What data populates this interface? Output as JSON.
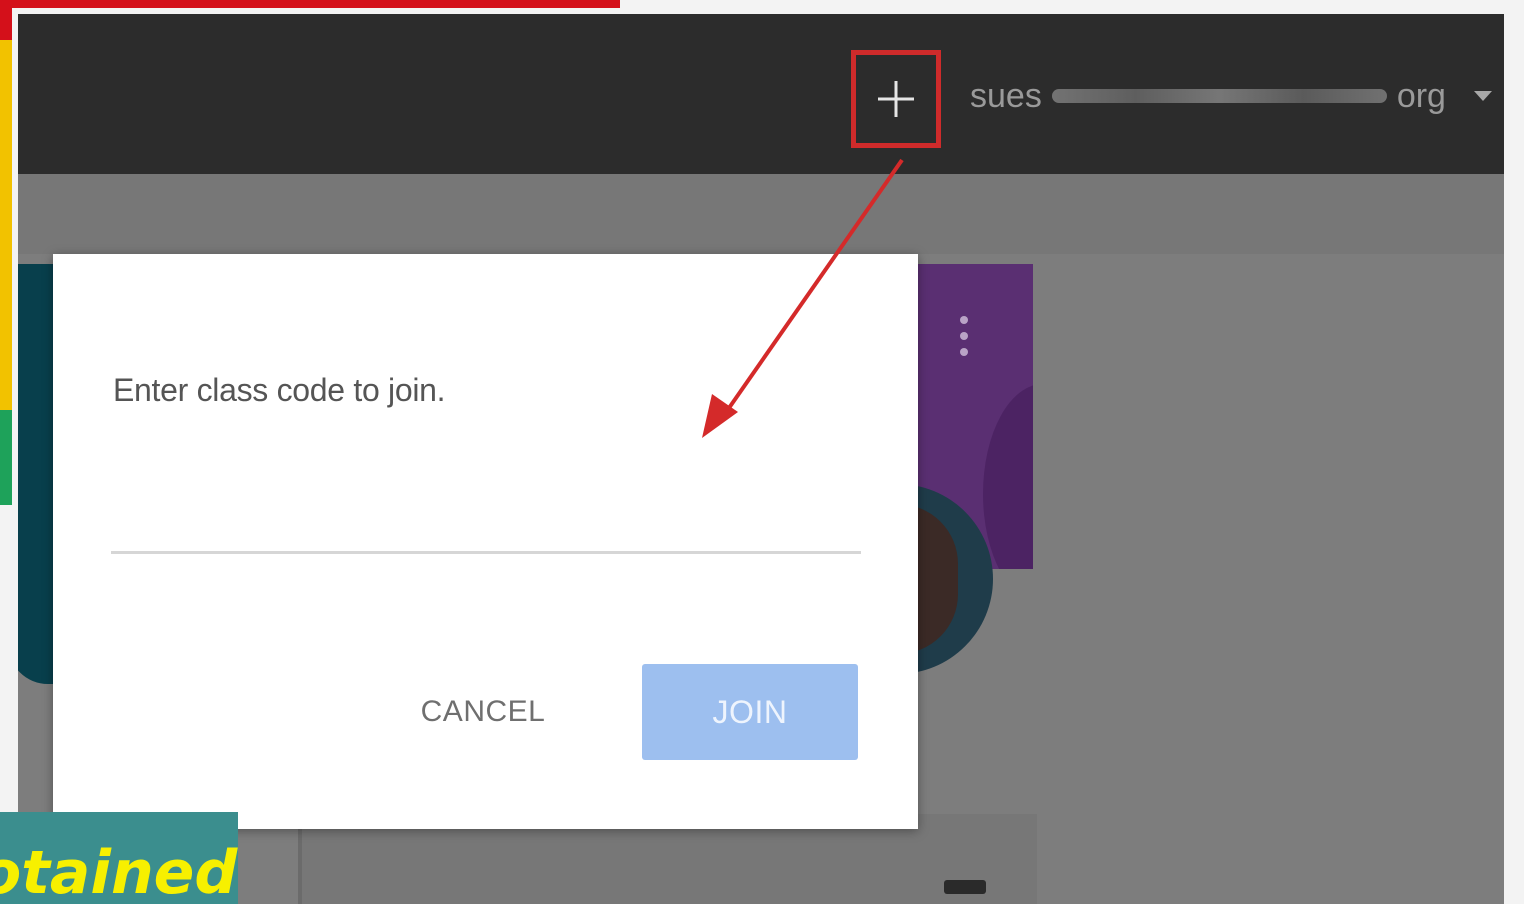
{
  "topbar": {
    "account_prefix": "sues",
    "account_suffix": "org"
  },
  "dialog": {
    "title": "Enter class code to join.",
    "input_value": "",
    "cancel_label": "CANCEL",
    "join_label": "JOIN"
  },
  "caption": {
    "text": "otained"
  },
  "icons": [
    "plus-icon",
    "caret-down-icon",
    "more-vert-icon",
    "arrow-annotation"
  ],
  "colors": {
    "topbar": "#2c2c2c",
    "highlight": "#cf2b2b",
    "join_button": "#9dbfef",
    "caption_bg": "#3b8e8e",
    "caption_text": "#f7f000"
  }
}
